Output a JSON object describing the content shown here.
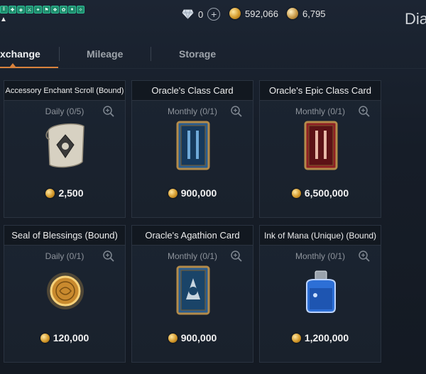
{
  "header": {
    "diamond_amount": "0",
    "gold_amount": "592,066",
    "silver_amount": "6,795",
    "title_partial": "Dia"
  },
  "tabs": [
    {
      "label": "xchange",
      "active": true
    },
    {
      "label": "Mileage",
      "active": false
    },
    {
      "label": "Storage",
      "active": false
    }
  ],
  "items": [
    {
      "name": "Accessory Enchant Scroll (Bound)",
      "limit": "Daily (0/5)",
      "price": "2,500",
      "icon": "enchant-scroll-icon"
    },
    {
      "name": "Oracle's Class Card",
      "limit": "Monthly (0/1)",
      "price": "900,000",
      "icon": "class-card-icon"
    },
    {
      "name": "Oracle's Epic Class Card",
      "limit": "Monthly (0/1)",
      "price": "6,500,000",
      "icon": "epic-class-card-icon"
    },
    {
      "name": "Seal of Blessings (Bound)",
      "limit": "Daily (0/1)",
      "price": "120,000",
      "icon": "seal-icon"
    },
    {
      "name": "Oracle's Agathion Card",
      "limit": "Monthly (0/1)",
      "price": "900,000",
      "icon": "agathion-card-icon"
    },
    {
      "name": "Ink of Mana (Unique) (Bound)",
      "limit": "Monthly (0/1)",
      "price": "1,200,000",
      "icon": "ink-bottle-icon"
    }
  ],
  "colors": {
    "accent": "#d9823c",
    "status_icon": "#1d8a6a",
    "gold": "#d49a2c"
  }
}
